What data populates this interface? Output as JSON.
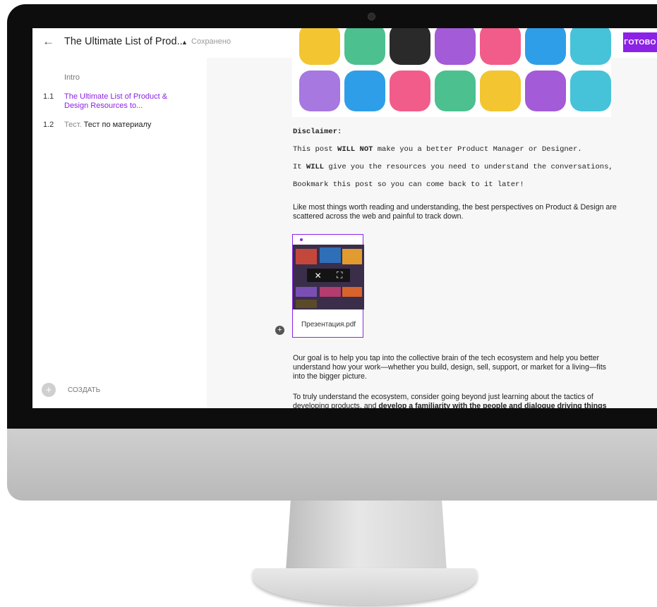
{
  "topbar": {
    "title": "The Ultimate List of Prod...",
    "save_status": "Сохранено",
    "done_label": "ГОТОВО"
  },
  "sidebar": {
    "intro": "Intro",
    "items": [
      {
        "num": "1.1",
        "text": "The Ultimate List of Product & Design Resources to..."
      },
      {
        "num": "1.2",
        "kind": "Тест.",
        "text": "Тест по материалу"
      }
    ],
    "create_label": "СОЗДАТЬ"
  },
  "content": {
    "disclaimer": "Disclaimer:",
    "line1_a": "This post ",
    "line1_b": "WILL NOT",
    "line1_c": " make you a better Product Manager or Designer.",
    "line2_a": "It ",
    "line2_b": "WILL",
    "line2_c": " give you the resources you need to understand the conversations,",
    "line3": "Bookmark this post so you can come back to it later!",
    "para1": "Like most things worth reading and understanding, the best perspectives on Product & Design are scattered across the web and painful to track down.",
    "attachment_name": "Презентация.pdf",
    "para2": "Our goal is to help you tap into the collective brain of the tech ecosystem and help you better understand how your work—whether you build, design, sell, support, or market for a living—fits into the bigger picture.",
    "para3_a": "To truly understand the ecosystem, consider going beyond just learning about the tactics of developing products, and ",
    "para3_b": "develop a familiarity with the people and dialogue driving things"
  },
  "colors": {
    "accent": "#8b22e6",
    "avatars": [
      "#a678e0",
      "#2f9ee8",
      "#f25c8a",
      "#4cc08f",
      "#f3c531",
      "#a35bd8",
      "#46c3d9"
    ]
  },
  "icons": {
    "back": "arrow-left-icon",
    "caret": "caret-up-icon",
    "create": "plus-circle-icon",
    "close": "close-icon",
    "fullscreen": "fullscreen-icon",
    "add_block": "plus-circle-icon"
  }
}
